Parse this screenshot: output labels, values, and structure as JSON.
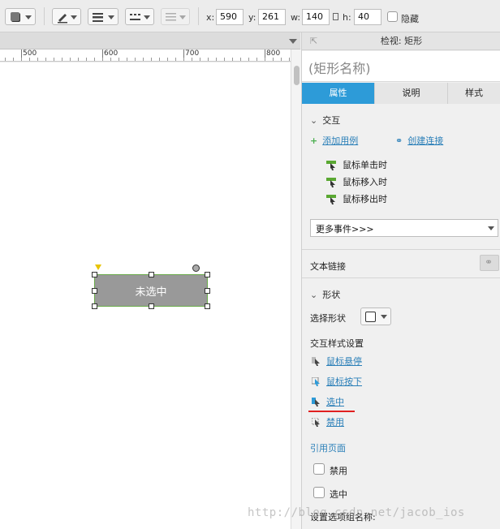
{
  "toolbar": {
    "x_label": "x:",
    "x_value": "590",
    "y_label": "y:",
    "y_value": "261",
    "w_label": "w:",
    "w_value": "140",
    "h_label": "h:",
    "h_value": "40",
    "hide_label": "隐藏"
  },
  "ruler": {
    "ticks": [
      "500",
      "600",
      "700",
      "800"
    ]
  },
  "canvas": {
    "widget_text": "未选中"
  },
  "inspector": {
    "title": "检视: 矩形",
    "name_placeholder": "(矩形名称)",
    "tabs": [
      "属性",
      "说明",
      "样式"
    ],
    "interaction_header": "交互",
    "add_case": "添加用例",
    "create_link": "创建连接",
    "events": [
      "鼠标单击时",
      "鼠标移入时",
      "鼠标移出时"
    ],
    "more_events": "更多事件>>>",
    "text_link": "文本链接",
    "shape_header": "形状",
    "select_shape": "选择形状",
    "interaction_style_header": "交互样式设置",
    "interaction_styles": [
      "鼠标悬停",
      "鼠标按下",
      "选中",
      "禁用"
    ],
    "ref_page": "引用页面",
    "disabled_label": "禁用",
    "selected_label": "选中",
    "group_name_label": "设置选项组名称:"
  },
  "watermark": "http://blog.csdn.net/jacob_ios",
  "colors": {
    "accent": "#2d9bd8",
    "link": "#2a7fb8",
    "highlight_underline": "#e02020",
    "widget_fill": "#999999"
  }
}
